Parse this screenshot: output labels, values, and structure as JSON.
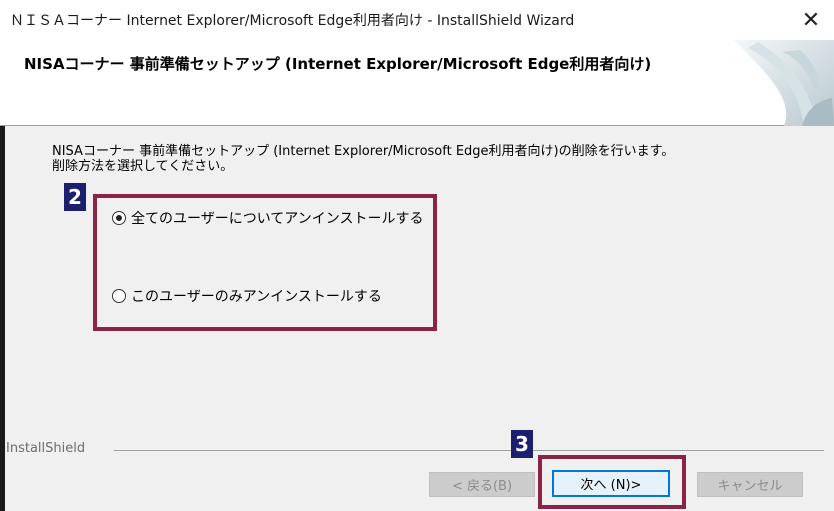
{
  "window": {
    "title": "ＮＩＳＡコーナー Internet Explorer/Microsoft Edge利用者向け - InstallShield Wizard",
    "close_glyph": "✕"
  },
  "header": {
    "title": "NISAコーナー 事前準備セットアップ (Internet Explorer/Microsoft Edge利用者向け)"
  },
  "content": {
    "description_line1": "NISAコーナー 事前準備セットアップ (Internet Explorer/Microsoft Edge利用者向け)の削除を行います。",
    "description_line2": "削除方法を選択してください。"
  },
  "options": [
    {
      "label": "全てのユーザーについてアンインストールする",
      "selected": true
    },
    {
      "label": "このユーザーのみアンインストールする",
      "selected": false
    }
  ],
  "annotations": {
    "badge_2": "2",
    "badge_3": "3",
    "highlight_color": "#8b2249",
    "badge_color": "#1b1f6e"
  },
  "footer": {
    "brand": "InstallShield",
    "back_button": "< 戻る(B)",
    "next_button": "次へ (N)>",
    "cancel_button": "キャンセル"
  }
}
